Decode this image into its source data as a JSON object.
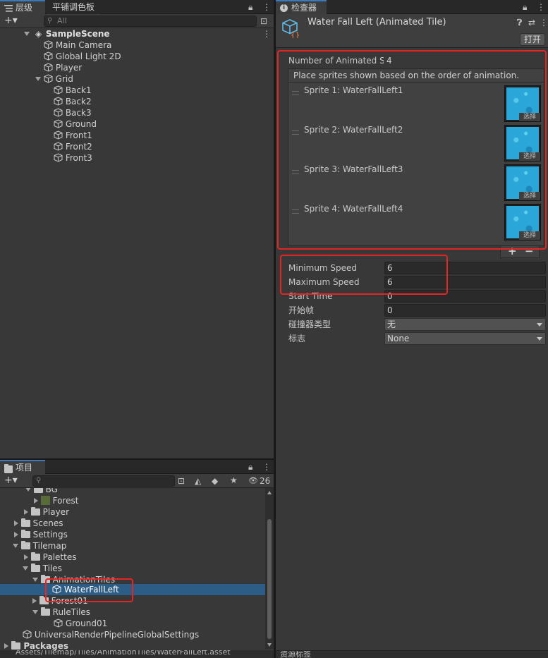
{
  "hierarchy": {
    "tab_label": "层级",
    "tab2_label": "平铺调色板",
    "search_placeholder": "All",
    "add_label": "+▾",
    "scene_name": "SampleScene",
    "items": [
      {
        "label": "Main Camera"
      },
      {
        "label": "Global Light 2D"
      },
      {
        "label": "Player"
      },
      {
        "label": "Grid"
      },
      {
        "label": "Back1"
      },
      {
        "label": "Back2"
      },
      {
        "label": "Back3"
      },
      {
        "label": "Ground"
      },
      {
        "label": "Front1"
      },
      {
        "label": "Front2"
      },
      {
        "label": "Front3"
      }
    ]
  },
  "project": {
    "tab_label": "项目",
    "add_label": "+▾",
    "visible_count": "26",
    "items": [
      {
        "label": "BG"
      },
      {
        "label": "Forest"
      },
      {
        "label": "Player"
      },
      {
        "label": "Scenes"
      },
      {
        "label": "Settings"
      },
      {
        "label": "Tilemap"
      },
      {
        "label": "Palettes"
      },
      {
        "label": "Tiles"
      },
      {
        "label": "AnimationTiles"
      },
      {
        "label": "WaterFallLeft"
      },
      {
        "label": "Forest01"
      },
      {
        "label": "RuleTiles"
      },
      {
        "label": "Ground01"
      },
      {
        "label": "UniversalRenderPipelineGlobalSettings"
      },
      {
        "label": "Packages"
      }
    ],
    "path": "Assets/Tilemap/Tiles/AnimationTiles/WaterFallLeft.asset"
  },
  "inspector": {
    "tab_label": "检查器",
    "title": "Water Fall Left (Animated Tile)",
    "open_button": "打开",
    "num_sprites_label": "Number of Animated S",
    "num_sprites_value": "4",
    "help_text": "Place sprites shown based on the order of animation.",
    "sprites": [
      {
        "label": "Sprite 1: WaterFallLeft1"
      },
      {
        "label": "Sprite 2: WaterFallLeft2"
      },
      {
        "label": "Sprite 3: WaterFallLeft3"
      },
      {
        "label": "Sprite 4: WaterFallLeft4"
      }
    ],
    "pick_label": "选择",
    "plus": "+",
    "minus": "−",
    "fields": [
      {
        "label": "Minimum Speed",
        "value": "6"
      },
      {
        "label": "Maximum Speed",
        "value": "6"
      },
      {
        "label": "Start Time",
        "value": "0"
      },
      {
        "label": "开始帧",
        "value": "0"
      }
    ],
    "collider_label": "碰撞器类型",
    "collider_value": "无",
    "flags_label": "标志",
    "flags_value": "None",
    "asset_labels": "资源标签"
  },
  "colors": {
    "accent": "#3a79bb",
    "selection": "#2c5d87",
    "highlight_box": "#e52424",
    "water": "#2aa6d8"
  }
}
